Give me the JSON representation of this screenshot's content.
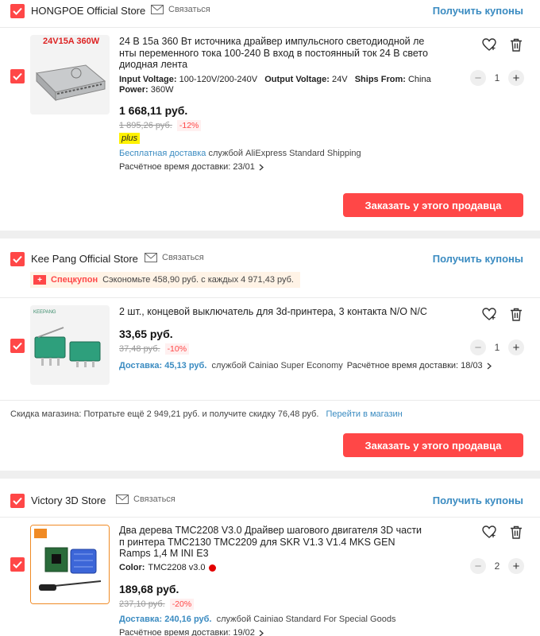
{
  "stores": [
    {
      "name": "HONGPOE Official Store",
      "contact_label": "Связаться",
      "coupons_label": "Получить купоны",
      "product": {
        "image_caption": "24V15A 360W",
        "title": "24 В 15а 360 Вт источника драйвер импульсного светодиодной ле нты переменного тока 100-240 В вход в постоянный ток 24 В свето диодная лента",
        "attrs": [
          {
            "label": "Input Voltage:",
            "value": "100-120V/200-240V"
          },
          {
            "label": "Output Voltage:",
            "value": "24V"
          },
          {
            "label": "Ships From:",
            "value": "China"
          },
          {
            "label": "Power:",
            "value": "360W"
          }
        ],
        "price": "1 668,11 руб.",
        "old_price": "1 895,26 руб.",
        "discount": "-12%",
        "badge": "plus",
        "shipping_highlight": "Бесплатная доставка",
        "shipping_rest": "службой AliExpress Standard Shipping",
        "eta": "Расчётное время доставки: 23/01",
        "quantity": "1"
      },
      "order_label": "Заказать у этого продавца"
    },
    {
      "name": "Kee Pang Official Store",
      "contact_label": "Связаться",
      "coupons_label": "Получить купоны",
      "coupon": {
        "tag": "+",
        "label": "Спецкупон",
        "text": "Сэкономьте 458,90 руб. с каждых 4 971,43 руб."
      },
      "product": {
        "image_caption": "KEEPANG",
        "title": "2 шт., концевой выключатель для 3d-принтера, 3 контакта N/O N/C",
        "price": "33,65 руб.",
        "old_price": "37,48 руб.",
        "discount": "-10%",
        "shipping_highlight": "Доставка: 45,13 руб.",
        "shipping_rest": "службой Cainiao Super Economy",
        "eta": "Расчётное время доставки: 18/03",
        "quantity": "1"
      },
      "store_discount": {
        "text": "Скидка магазина:  Потратьте ещё 2 949,21 руб. и получите скидку 76,48 руб.",
        "link": "Перейти в магазин"
      },
      "order_label": "Заказать у этого продавца"
    },
    {
      "name": "Victory 3D Store",
      "contact_label": "Связаться",
      "coupons_label": "Получить купоны",
      "product": {
        "title": "Два дерева TMC2208 V3.0 Драйвер шагового двигателя 3D части п ринтера TMC2130 TMC2209 для SKR V1.3 V1.4 MKS GEN Ramps 1,4 M INI E3",
        "color_label": "Color:",
        "color_value": "TMC2208 v3.0",
        "price": "189,68 руб.",
        "old_price": "237,10 руб.",
        "discount": "-20%",
        "shipping_highlight": "Доставка: 240,16 руб.",
        "shipping_rest": "службой Cainiao Standard For Special Goods",
        "eta": "Расчётное время доставки: 19/02",
        "quantity": "2"
      }
    }
  ],
  "colors": {
    "accent": "#ff4747",
    "link": "#3a8bc1",
    "plus_badge": "#fff200"
  }
}
